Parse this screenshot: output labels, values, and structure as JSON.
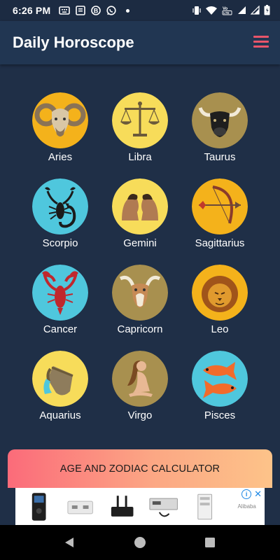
{
  "status_bar": {
    "time": "6:26 PM",
    "icons_left": [
      "keyboard-icon",
      "news-icon",
      "b-app-icon",
      "whatsapp-icon",
      "dot-icon"
    ],
    "icons_right": [
      "vibrate-icon",
      "wifi-icon",
      "volte-icon",
      "signal-icon",
      "signal-icon",
      "battery-icon"
    ]
  },
  "app_bar": {
    "title": "Daily Horoscope",
    "menu_icon": "hamburger-menu-icon",
    "menu_color": "#e8556a"
  },
  "signs": [
    {
      "name": "Aries",
      "icon": "ram-icon",
      "bg": "#f4b21b"
    },
    {
      "name": "Libra",
      "icon": "scales-icon",
      "bg": "#f7dc5a"
    },
    {
      "name": "Taurus",
      "icon": "bull-icon",
      "bg": "#a8904f"
    },
    {
      "name": "Scorpio",
      "icon": "scorpion-icon",
      "bg": "#4fc7dd"
    },
    {
      "name": "Gemini",
      "icon": "twins-icon",
      "bg": "#f7dc5a"
    },
    {
      "name": "Sagittarius",
      "icon": "bow-arrow-icon",
      "bg": "#f4b21b"
    },
    {
      "name": "Cancer",
      "icon": "crab-icon",
      "bg": "#4fc7dd"
    },
    {
      "name": "Capricorn",
      "icon": "goat-icon",
      "bg": "#a8904f"
    },
    {
      "name": "Leo",
      "icon": "lion-icon",
      "bg": "#f4b21b"
    },
    {
      "name": "Aquarius",
      "icon": "water-jar-icon",
      "bg": "#f7dc5a"
    },
    {
      "name": "Virgo",
      "icon": "maiden-icon",
      "bg": "#a8904f"
    },
    {
      "name": "Pisces",
      "icon": "fish-icon",
      "bg": "#4fc7dd"
    }
  ],
  "calculator_button": {
    "label": "AGE AND ZODIAC CALCULATOR"
  },
  "ad": {
    "info_glyph": "i",
    "close_glyph": "✕"
  },
  "nav_bar": {
    "buttons": [
      "back-icon",
      "home-icon",
      "recents-icon"
    ]
  }
}
